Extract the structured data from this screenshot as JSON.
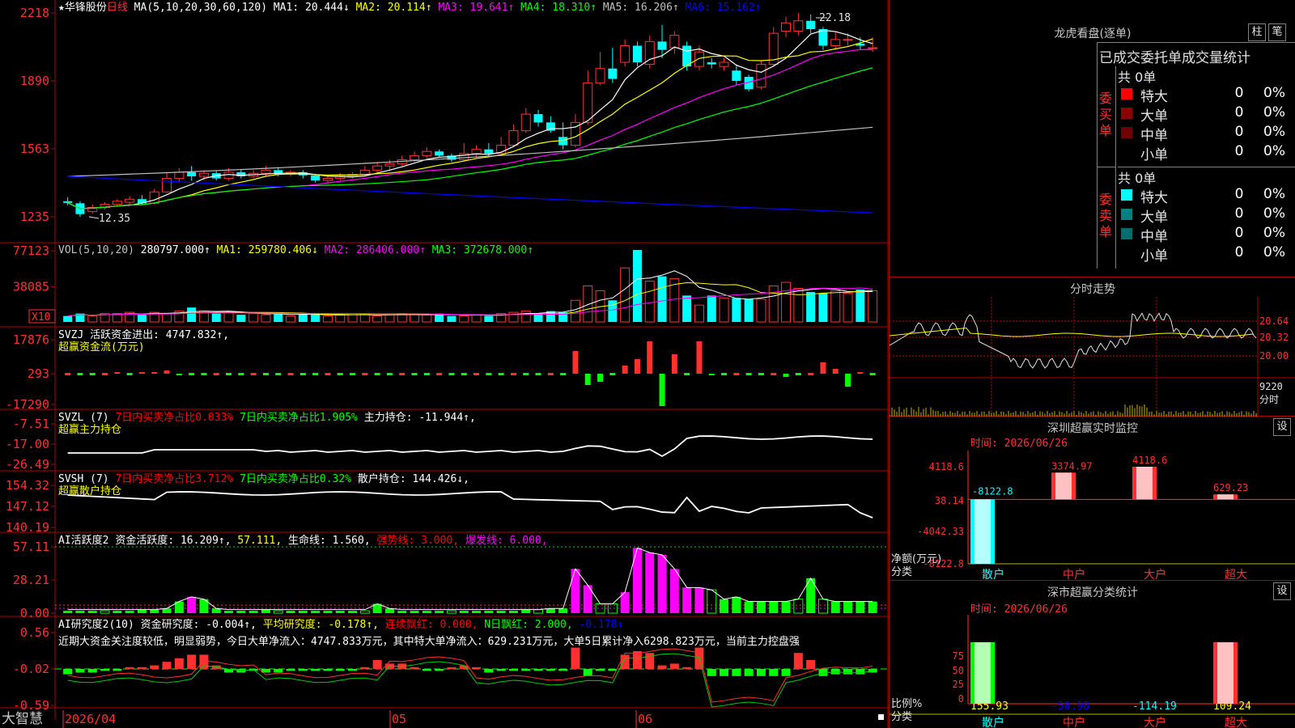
{
  "header": {
    "title": "★华锋股份",
    "period": "日线",
    "ma_spec": "MA(5,10,20,30,60,120)",
    "ma_values": [
      {
        "label": "MA1: 20.444↓",
        "color": "#ffffff"
      },
      {
        "label": "MA2: 20.114↑",
        "color": "#ffff00"
      },
      {
        "label": "MA3: 19.641↑",
        "color": "#ff00ff"
      },
      {
        "label": "MA4: 18.310↑",
        "color": "#00ff00"
      },
      {
        "label": "MA5: 16.206↑",
        "color": "#c0c0c0"
      },
      {
        "label": "MA6: 15.162↑",
        "color": "#0000ff"
      }
    ]
  },
  "price_panel": {
    "y_ticks": [
      "2218",
      "1890",
      "1563",
      "1235"
    ],
    "high_label": "22.18",
    "low_label": "12.35"
  },
  "vol_panel": {
    "y_ticks": [
      "77123",
      "38085"
    ],
    "unit": "X10",
    "spec": "VOL(5,10,20)",
    "values": [
      {
        "label": "280797.000↑",
        "color": "#ffffff"
      },
      {
        "label": "MA1: 259780.406↓",
        "color": "#ffff00"
      },
      {
        "label": "MA2: 286406.000↑",
        "color": "#ff00ff"
      },
      {
        "label": "MA3: 372678.000↑",
        "color": "#00ff00"
      }
    ]
  },
  "svzj_panel": {
    "y_ticks": [
      "17876",
      "293",
      "-17290"
    ],
    "line1": [
      {
        "label": "SVZJ  活跃资金进出: 4747.832↑,",
        "color": "#ffffff"
      }
    ],
    "line2": "超赢资金流(万元)"
  },
  "svzl_panel": {
    "y_ticks": [
      "-7.51",
      "-17.00",
      "-26.49"
    ],
    "line1": [
      {
        "label": "SVZL (7)",
        "color": "#ffffff"
      },
      {
        "label": "7日内买卖净占比0.033%",
        "color": "#ff0000"
      },
      {
        "label": "7日内买卖净占比1.905%",
        "color": "#00ff00"
      },
      {
        "label": "主力持仓: -11.944↑,",
        "color": "#ffffff"
      }
    ],
    "line2": "超赢主力持仓"
  },
  "svsh_panel": {
    "y_ticks": [
      "154.32",
      "147.12",
      "140.19"
    ],
    "line1": [
      {
        "label": "SVSH (7)",
        "color": "#ffffff"
      },
      {
        "label": "7日内买卖净占比3.712%",
        "color": "#ff0000"
      },
      {
        "label": "7日内买卖净占比0.32%",
        "color": "#00ff00"
      },
      {
        "label": "散户持仓: 144.426↓,",
        "color": "#ffffff"
      }
    ],
    "line2": "超赢散户持仓"
  },
  "ai_active_panel": {
    "y_ticks": [
      "57.11",
      "28.21",
      "0.00"
    ],
    "line1": [
      {
        "label": "AI活跃度2",
        "color": "#ffffff"
      },
      {
        "label": "资金活跃度: 16.209↑,",
        "color": "#ffffff"
      },
      {
        "label": "57.111,",
        "color": "#ffff00"
      },
      {
        "label": "生命线: 1.560,",
        "color": "#ffffff"
      },
      {
        "label": "强势线: 3.000,",
        "color": "#ff0000"
      },
      {
        "label": "爆发线: 6.000,",
        "color": "#ff00ff"
      }
    ]
  },
  "ai_research_panel": {
    "y_ticks": [
      "0.56",
      "-0.02",
      "-0.59"
    ],
    "line1": [
      {
        "label": "AI研究度2(10)",
        "color": "#ffffff"
      },
      {
        "label": "资金研究度: -0.004↑,",
        "color": "#ffffff"
      },
      {
        "label": "平均研究度: -0.178↑,",
        "color": "#ffff00"
      },
      {
        "label": "连续飘红: 0.000,",
        "color": "#ff0000"
      },
      {
        "label": "N日飘红: 2.000,",
        "color": "#00ff00"
      },
      {
        "label": "-0.178↑",
        "color": "#0000ff"
      }
    ],
    "comment": "近期大资金关注度较低，明显弱势，今日大单净流入：4747.833万元，其中特大单净流入：629.231万元，大单5日累计净入6298.823万元，当前主力控盘强"
  },
  "x_axis": {
    "labels": [
      "2026/04",
      "05",
      "06"
    ],
    "footer_brand": "大智慧"
  },
  "right": {
    "lh": {
      "title": "龙虎看盘(逐单)",
      "btn_bar": "柱",
      "btn_brush": "笔",
      "tabs": "已成交委托单成交量统计",
      "buy_label": "委买单",
      "sell_label": "委卖单",
      "buy_total": "共 0单",
      "sell_total": "共 0单",
      "buy_rows": [
        {
          "name": "特大",
          "val": "0",
          "pct": "0%",
          "color": "#ff0000"
        },
        {
          "name": "大单",
          "val": "0",
          "pct": "0%",
          "color": "#8b0000"
        },
        {
          "name": "中单",
          "val": "0",
          "pct": "0%",
          "color": "#6e0000"
        },
        {
          "name": "小单",
          "val": "0",
          "pct": "0%",
          "color": "#000000"
        }
      ],
      "sell_rows": [
        {
          "name": "特大",
          "val": "0",
          "pct": "0%",
          "color": "#00ffff"
        },
        {
          "name": "大单",
          "val": "0",
          "pct": "0%",
          "color": "#008080"
        },
        {
          "name": "中单",
          "val": "0",
          "pct": "0%",
          "color": "#006e6e"
        },
        {
          "name": "小单",
          "val": "0",
          "pct": "0%",
          "color": "#000000"
        }
      ]
    },
    "intraday": {
      "title": "分时走势",
      "y_right": [
        "20.64",
        "20.32",
        "20.00"
      ],
      "vol_label": "9220",
      "vol_unit": "分时"
    },
    "monitor": {
      "title": "深圳超赢实时监控",
      "setting": "设",
      "time_label": "时间: 2026/06/26",
      "y_ticks": [
        "4118.6",
        "38.14",
        "-4042.33",
        "-8122.8"
      ],
      "y_title_1": "净额(万元)",
      "y_title_2": "分类",
      "categories": [
        "散户",
        "中户",
        "大户",
        "超大"
      ],
      "bar_values": [
        -8122.8,
        3374.97,
        4118.6,
        629.23
      ],
      "bar_labels": [
        "-8122.8",
        "3374.97",
        "4118.6",
        "629.23"
      ]
    },
    "classify": {
      "title": "深市超赢分类统计",
      "setting": "设",
      "time_label": "时间: 2026/06/26",
      "y_ticks": [
        "75",
        "50",
        "25",
        "0"
      ],
      "y_title_1": "比例%",
      "y_title_2": "分类",
      "categories": [
        "散户",
        "中户",
        "大户",
        "超大"
      ],
      "values": [
        "155.93",
        "-50.98",
        "-114.19",
        "109.24"
      ],
      "value_colors": [
        "#ffff00",
        "#0000ff",
        "#00ffff",
        "#ffff00"
      ],
      "bar_values": [
        155.93,
        -50.98,
        -114.19,
        109.24
      ]
    }
  },
  "chart_data": {
    "type": "candlestick",
    "candles": [
      {
        "o": 13.1,
        "c": 13.02,
        "h": 13.3,
        "l": 12.9
      },
      {
        "o": 13.0,
        "c": 12.48,
        "h": 13.1,
        "l": 12.35
      },
      {
        "o": 12.6,
        "c": 12.8,
        "h": 12.95,
        "l": 12.5
      },
      {
        "o": 12.8,
        "c": 12.95,
        "h": 13.05,
        "l": 12.7
      },
      {
        "o": 12.95,
        "c": 13.1,
        "h": 13.2,
        "l": 12.85
      },
      {
        "o": 13.05,
        "c": 13.2,
        "h": 13.35,
        "l": 12.95
      },
      {
        "o": 13.2,
        "c": 13.0,
        "h": 13.4,
        "l": 12.9
      },
      {
        "o": 13.0,
        "c": 13.55,
        "h": 13.7,
        "l": 12.95
      },
      {
        "o": 13.55,
        "c": 14.2,
        "h": 14.5,
        "l": 13.5
      },
      {
        "o": 14.2,
        "c": 14.5,
        "h": 14.7,
        "l": 14.0
      },
      {
        "o": 14.5,
        "c": 14.3,
        "h": 14.8,
        "l": 14.1
      },
      {
        "o": 14.3,
        "c": 14.45,
        "h": 14.6,
        "l": 14.1
      },
      {
        "o": 14.45,
        "c": 14.2,
        "h": 14.6,
        "l": 14.1
      },
      {
        "o": 14.2,
        "c": 14.5,
        "h": 14.7,
        "l": 14.1
      },
      {
        "o": 14.5,
        "c": 14.3,
        "h": 14.65,
        "l": 14.2
      },
      {
        "o": 14.3,
        "c": 14.45,
        "h": 14.6,
        "l": 14.2
      },
      {
        "o": 14.45,
        "c": 14.6,
        "h": 14.8,
        "l": 14.3
      },
      {
        "o": 14.6,
        "c": 14.4,
        "h": 14.75,
        "l": 14.3
      },
      {
        "o": 14.4,
        "c": 14.5,
        "h": 14.6,
        "l": 14.3
      },
      {
        "o": 14.5,
        "c": 14.35,
        "h": 14.6,
        "l": 14.2
      },
      {
        "o": 14.35,
        "c": 14.1,
        "h": 14.4,
        "l": 14.0
      },
      {
        "o": 14.1,
        "c": 14.2,
        "h": 14.3,
        "l": 14.0
      },
      {
        "o": 14.2,
        "c": 14.3,
        "h": 14.45,
        "l": 14.1
      },
      {
        "o": 14.3,
        "c": 14.4,
        "h": 14.5,
        "l": 14.2
      },
      {
        "o": 14.4,
        "c": 14.6,
        "h": 14.8,
        "l": 14.35
      },
      {
        "o": 14.6,
        "c": 14.8,
        "h": 15.0,
        "l": 14.5
      },
      {
        "o": 14.8,
        "c": 14.9,
        "h": 15.1,
        "l": 14.6
      },
      {
        "o": 14.9,
        "c": 15.1,
        "h": 15.3,
        "l": 14.8
      },
      {
        "o": 15.1,
        "c": 15.3,
        "h": 15.5,
        "l": 15.0
      },
      {
        "o": 15.3,
        "c": 15.5,
        "h": 15.7,
        "l": 15.2
      },
      {
        "o": 15.5,
        "c": 15.3,
        "h": 15.6,
        "l": 15.2
      },
      {
        "o": 15.3,
        "c": 15.1,
        "h": 15.4,
        "l": 15.0
      },
      {
        "o": 15.1,
        "c": 15.4,
        "h": 15.9,
        "l": 15.0
      },
      {
        "o": 15.4,
        "c": 15.6,
        "h": 15.8,
        "l": 15.2
      },
      {
        "o": 15.6,
        "c": 15.4,
        "h": 15.9,
        "l": 15.3
      },
      {
        "o": 15.4,
        "c": 15.8,
        "h": 16.2,
        "l": 15.3
      },
      {
        "o": 15.8,
        "c": 16.5,
        "h": 16.8,
        "l": 15.7
      },
      {
        "o": 16.5,
        "c": 17.3,
        "h": 17.6,
        "l": 16.4
      },
      {
        "o": 17.3,
        "c": 16.9,
        "h": 17.5,
        "l": 16.7
      },
      {
        "o": 16.9,
        "c": 16.5,
        "h": 17.2,
        "l": 16.4
      },
      {
        "o": 16.2,
        "c": 15.8,
        "h": 16.9,
        "l": 15.6
      },
      {
        "o": 15.8,
        "c": 16.9,
        "h": 17.3,
        "l": 15.7
      },
      {
        "o": 16.9,
        "c": 18.8,
        "h": 19.4,
        "l": 16.8
      },
      {
        "o": 18.8,
        "c": 19.5,
        "h": 20.3,
        "l": 18.7
      },
      {
        "o": 19.5,
        "c": 19.0,
        "h": 20.5,
        "l": 18.8
      },
      {
        "o": 19.8,
        "c": 20.6,
        "h": 20.9,
        "l": 19.6
      },
      {
        "o": 20.6,
        "c": 19.8,
        "h": 20.8,
        "l": 19.6
      },
      {
        "o": 19.7,
        "c": 20.8,
        "h": 21.1,
        "l": 19.5
      },
      {
        "o": 20.8,
        "c": 20.4,
        "h": 21.6,
        "l": 20.0
      },
      {
        "o": 20.5,
        "c": 21.1,
        "h": 21.3,
        "l": 20.2
      },
      {
        "o": 20.6,
        "c": 19.6,
        "h": 20.8,
        "l": 19.4
      },
      {
        "o": 19.6,
        "c": 20.3,
        "h": 20.6,
        "l": 19.4
      },
      {
        "o": 19.8,
        "c": 19.7,
        "h": 20.0,
        "l": 19.5
      },
      {
        "o": 19.6,
        "c": 19.8,
        "h": 20.0,
        "l": 19.4
      },
      {
        "o": 19.4,
        "c": 18.9,
        "h": 19.7,
        "l": 18.7
      },
      {
        "o": 19.1,
        "c": 18.5,
        "h": 19.2,
        "l": 18.4
      },
      {
        "o": 18.6,
        "c": 19.7,
        "h": 19.9,
        "l": 18.5
      },
      {
        "o": 19.7,
        "c": 21.2,
        "h": 21.5,
        "l": 19.6
      },
      {
        "o": 21.3,
        "c": 21.7,
        "h": 22.0,
        "l": 21.0
      },
      {
        "o": 21.3,
        "c": 21.8,
        "h": 22.18,
        "l": 21.1
      },
      {
        "o": 21.8,
        "c": 21.4,
        "h": 22.1,
        "l": 21.2
      },
      {
        "o": 21.4,
        "c": 20.6,
        "h": 21.5,
        "l": 20.4
      },
      {
        "o": 20.6,
        "c": 20.9,
        "h": 21.3,
        "l": 20.4
      },
      {
        "o": 20.9,
        "c": 20.9,
        "h": 21.2,
        "l": 20.6
      },
      {
        "o": 20.7,
        "c": 20.6,
        "h": 21.0,
        "l": 20.4
      },
      {
        "o": 20.5,
        "c": 20.5,
        "h": 21.0,
        "l": 20.3
      }
    ]
  }
}
